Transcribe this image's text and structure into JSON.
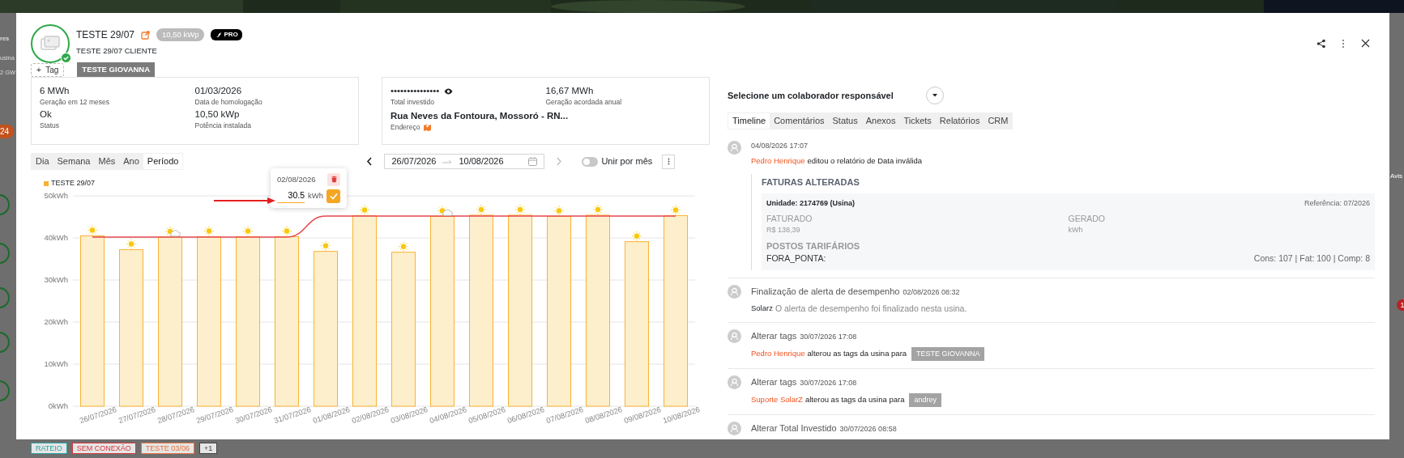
{
  "background": {
    "fragments": [
      "res",
      "usina",
      "2 GW"
    ],
    "counter": "24",
    "side_label": "Avis",
    "notification_count": "1",
    "tags": [
      {
        "label": "RATEIO",
        "color": "#2aa5a0"
      },
      {
        "label": "SEM CONEXÃO",
        "color": "#d9363e"
      },
      {
        "label": "TESTE 03/06",
        "color": "#e8743b"
      },
      {
        "label": "+1",
        "color": "#444444"
      }
    ]
  },
  "header": {
    "title": "TESTE 29/07",
    "power_badge": "10,50 kWp",
    "plan_badge": "PRO",
    "subtitle": "TESTE 29/07 CLIENTE",
    "verified": true,
    "add_tag_icon": "+",
    "add_tag": "Tag",
    "tags": [
      "TESTE GIOVANNA"
    ]
  },
  "info_cards": [
    {
      "fields": [
        {
          "kind": "plain",
          "value": "6 MWh",
          "label": "Geração em 12 meses"
        },
        {
          "kind": "plain",
          "value": "01/03/2026",
          "label": "Data de homologação"
        },
        {
          "kind": "plain",
          "value": "Ok",
          "label": "Status"
        },
        {
          "kind": "plain",
          "value": "10,50 kWp",
          "label": "Potência instalada"
        }
      ]
    },
    {
      "fields": [
        {
          "kind": "masked",
          "value": "•••••••••••••••",
          "label": "Total investido"
        },
        {
          "kind": "plain",
          "value": "16,67 MWh",
          "label": "Geração acordada anual"
        },
        {
          "kind": "address",
          "value": "Rua Neves da Fontoura, Mossoró - RN...",
          "label": "Endereço"
        }
      ]
    }
  ],
  "period_tabs": [
    {
      "label": "Dia",
      "selected": false
    },
    {
      "label": "Semana",
      "selected": false
    },
    {
      "label": "Mês",
      "selected": false
    },
    {
      "label": "Ano",
      "selected": false
    },
    {
      "label": "Período",
      "selected": true
    }
  ],
  "date_range": {
    "start": "26/07/2026",
    "end": "10/08/2026",
    "next_disabled": true
  },
  "merge_toggle": {
    "label": "Unir por mês",
    "on": false
  },
  "chart": {
    "weather": [
      {
        "kind": "sun"
      },
      {
        "kind": "sun"
      },
      {
        "kind": "partly_cloudy"
      },
      {
        "kind": "sun"
      },
      {
        "kind": "sun"
      },
      {
        "kind": "sun"
      },
      {
        "kind": "sun"
      },
      {
        "kind": "sun"
      },
      {
        "kind": "sun"
      },
      {
        "kind": "partly_cloudy"
      },
      {
        "kind": "sun"
      },
      {
        "kind": "sun"
      },
      {
        "kind": "sun"
      },
      {
        "kind": "sun"
      },
      {
        "kind": "sun"
      },
      {
        "kind": "sun"
      }
    ],
    "editor": {
      "date": "02/08/2026",
      "value": "30.5",
      "unit": "kWh"
    },
    "chart_data": {
      "type": "bar",
      "categories": [
        "26/07/2026",
        "27/07/2026",
        "28/07/2026",
        "29/07/2026",
        "30/07/2026",
        "31/07/2026",
        "01/08/2026",
        "02/08/2026",
        "03/08/2026",
        "04/08/2026",
        "05/08/2026",
        "06/08/2026",
        "07/08/2026",
        "08/08/2026",
        "09/08/2026",
        "10/08/2026"
      ],
      "series": [
        {
          "name": "TESTE 29/07",
          "color": "#f9b233",
          "values": [
            40.5,
            37.2,
            40.2,
            40.3,
            40.3,
            40.3,
            36.8,
            45.3,
            36.6,
            45.1,
            45.4,
            45.4,
            45.1,
            45.4,
            39.1,
            45.3
          ]
        },
        {
          "type": "line",
          "color": "#e5484d",
          "values": [
            40.2,
            40.2,
            40.2,
            40.2,
            40.2,
            40.2,
            45.2,
            45.2,
            45.2,
            45.2,
            45.2,
            45.2,
            45.2,
            45.2,
            45.2,
            45.2
          ]
        }
      ],
      "grid": true,
      "ylim": [
        0,
        50
      ],
      "yticks": [
        {
          "value": 0,
          "label": "0kWh"
        },
        {
          "value": 10,
          "label": "10kWh"
        },
        {
          "value": 20,
          "label": "20kWh"
        },
        {
          "value": 30,
          "label": "30kWh"
        },
        {
          "value": 40,
          "label": "40kWh"
        },
        {
          "value": 50,
          "label": "50kWh"
        }
      ]
    }
  },
  "collaborator": {
    "label": "Selecione um colaborador responsável"
  },
  "detail_tabs": [
    {
      "label": "Timeline",
      "selected": true
    },
    {
      "label": "Comentários",
      "selected": false
    },
    {
      "label": "Status",
      "selected": false
    },
    {
      "label": "Anexos",
      "selected": false
    },
    {
      "label": "Tickets",
      "selected": false
    },
    {
      "label": "Relatórios",
      "selected": false
    },
    {
      "label": "CRM",
      "selected": false
    }
  ],
  "timeline": [
    {
      "date": "04/08/2026 17:07",
      "author": {
        "name": "Pedro Henrique",
        "kind": "user"
      },
      "text": "editou o relatório de Data inválida",
      "muted": false,
      "details": {
        "heading": "FATURAS ALTERADAS",
        "unit": "Unidade: 2174769 (Usina)",
        "reference": "Referência: 07/2026",
        "columns": [
          {
            "label": "FATURADO",
            "value": "R$ 138,39"
          },
          {
            "label": "GERADO",
            "value": "kWh"
          }
        ],
        "section": "POSTOS TARIFÁRIOS",
        "rows": [
          {
            "name": "FORA_PONTA:",
            "values": "Cons: 107 | Fat: 100 | Comp: 8"
          }
        ]
      }
    },
    {
      "title": "Finalização de alerta de desempenho",
      "date": "02/08/2026 08:32",
      "author": {
        "name": "Solarz",
        "kind": "system"
      },
      "text": "O alerta de desempenho foi finalizado nesta usina.",
      "muted": true
    },
    {
      "title": "Alterar tags",
      "date": "30/07/2026 17:08",
      "author": {
        "name": "Pedro Henrique",
        "kind": "user"
      },
      "text": "alterou as tags da usina para",
      "muted": false,
      "tag": "TESTE GIOVANNA"
    },
    {
      "title": "Alterar tags",
      "date": "30/07/2026 17:08",
      "author": {
        "name": "Suporte SolarZ",
        "kind": "user"
      },
      "text": "alterou as tags da usina para",
      "muted": false,
      "tag": "andrey"
    },
    {
      "title": "Alterar Total Investido",
      "date": "30/07/2026 08:58"
    }
  ]
}
